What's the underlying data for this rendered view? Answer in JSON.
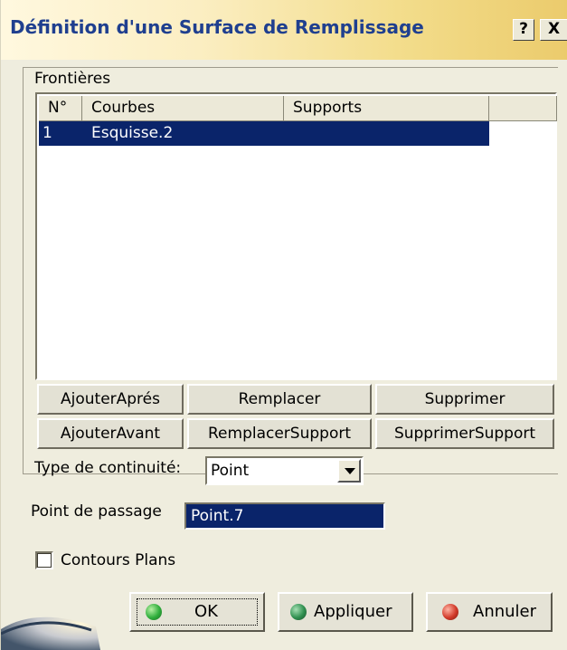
{
  "window": {
    "title": "Définition d'une Surface de Remplissage",
    "help_label": "?",
    "close_label": "X"
  },
  "group": {
    "label": "Frontières"
  },
  "table": {
    "columns": [
      "N°",
      "Courbes",
      "Supports"
    ],
    "rows": [
      {
        "num": "1",
        "courbe": "Esquisse.2",
        "support": ""
      }
    ]
  },
  "buttons": {
    "ajouter_apres": "AjouterAprés",
    "remplacer": "Remplacer",
    "supprimer": "Supprimer",
    "ajouter_avant": "AjouterAvant",
    "remplacer_support": "RemplacerSupport",
    "supprimer_support": "SupprimerSupport"
  },
  "continuity": {
    "label": "Type de continuité:",
    "value": "Point"
  },
  "passage": {
    "label": "Point de passage",
    "value": "Point.7"
  },
  "contours": {
    "label": "Contours Plans",
    "checked": false
  },
  "footer": {
    "ok": "OK",
    "apply": "Appliquer",
    "cancel": "Annuler"
  },
  "colors": {
    "selection": "#0a246a",
    "title_text": "#1f3f8f",
    "ok_dot": "#2fae3c",
    "apply_dot": "#2f8f4f",
    "cancel_dot": "#d23a2a"
  }
}
